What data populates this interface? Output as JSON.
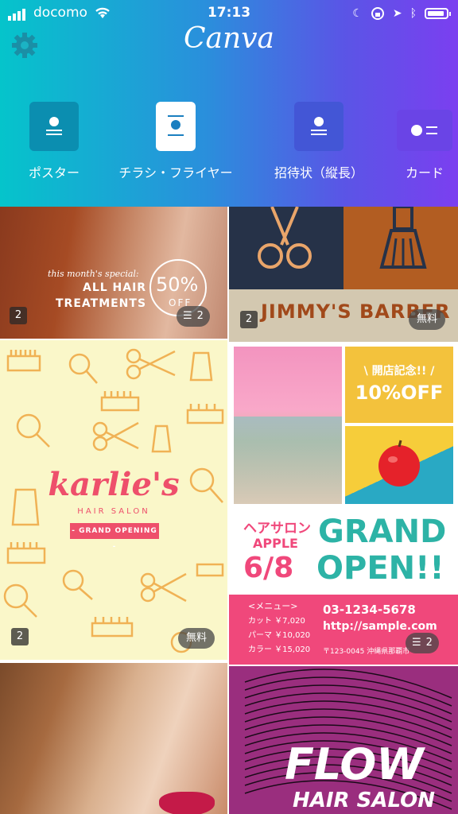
{
  "status_bar": {
    "carrier": "docomo",
    "time": "17:13"
  },
  "app": {
    "logo": "Canva"
  },
  "categories": [
    {
      "label": "ポスター"
    },
    {
      "label": "チラシ・フライヤー"
    },
    {
      "label": "招待状（縦長）"
    },
    {
      "label": "カード"
    }
  ],
  "tiles": {
    "hair_treatment": {
      "kicker": "this month's special:",
      "line1": "ALL HAIR",
      "line2": "TREATMENTS",
      "percent": "50%",
      "off": "OFF",
      "pages": "2",
      "layers": "2"
    },
    "barber": {
      "title": "JIMMY'S BARBER",
      "pages": "2",
      "price": "無料"
    },
    "karlies": {
      "name": "karlie's",
      "sub": "HAIR SALON",
      "ribbon": "- GRAND OPENING -",
      "pages": "2",
      "price": "無料"
    },
    "apple": {
      "anniv": "\\ 開店記念!! /",
      "discount": "10%OFF",
      "salon": "ヘアサロン",
      "salon_name": "APPLE",
      "date": "6/8",
      "grand": "GRAND",
      "open": "OPEN!!",
      "menu_title": "<メニュー>",
      "menu1": "カット ￥7,020",
      "menu2": "パーマ ￥10,020",
      "menu3": "カラー ￥15,020",
      "phone": "03-1234-5678",
      "url": "http://sample.com",
      "address": "〒123-0045  沖縄県那覇市",
      "layers": "2"
    },
    "flow": {
      "title": "FLOW",
      "sub": "HAIR SALON"
    }
  },
  "colors": {
    "gradient_start": "#05c4cb",
    "gradient_end": "#7b3ff0",
    "pink": "#f0487b",
    "teal": "#2db3a6"
  }
}
